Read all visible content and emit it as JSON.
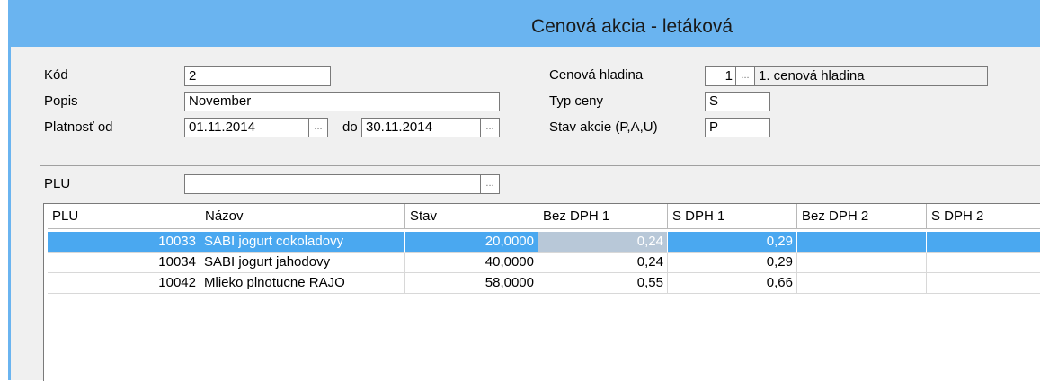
{
  "window": {
    "title": "Cenová akcia - letáková"
  },
  "form": {
    "kod_label": "Kód",
    "kod_value": "2",
    "popis_label": "Popis",
    "popis_value": "November",
    "platnost_label": "Platnosť od",
    "platnost_od_value": "01.11.2014",
    "do_label": "do",
    "platnost_do_value": "30.11.2014",
    "cenova_hladina_label": "Cenová hladina",
    "cenova_hladina_value": "1",
    "cenova_hladina_name": "1. cenová hladina",
    "typ_ceny_label": "Typ ceny",
    "typ_ceny_value": "S",
    "stav_akcie_label": "Stav akcie (P,A,U)",
    "stav_akcie_value": "P",
    "plu_label": "PLU",
    "plu_value": "",
    "lookup_dots": "..."
  },
  "grid": {
    "columns": [
      "PLU",
      "Názov",
      "Stav",
      "Bez DPH 1",
      "S DPH 1",
      "Bez DPH 2",
      "S DPH 2"
    ],
    "rows": [
      [
        "10033",
        "SABI jogurt cokoladovy",
        "20,0000",
        "0,24",
        "0,29",
        "",
        ""
      ],
      [
        "10034",
        "SABI jogurt jahodovy",
        "40,0000",
        "0,24",
        "0,29",
        "",
        ""
      ],
      [
        "10042",
        "Mlieko plnotucne RAJO",
        "58,0000",
        "0,55",
        "0,66",
        "",
        ""
      ]
    ]
  },
  "colors": {
    "title_bar": "#6ab4f0",
    "selection": "#4aa8f0",
    "panel": "#f0f0f0"
  }
}
